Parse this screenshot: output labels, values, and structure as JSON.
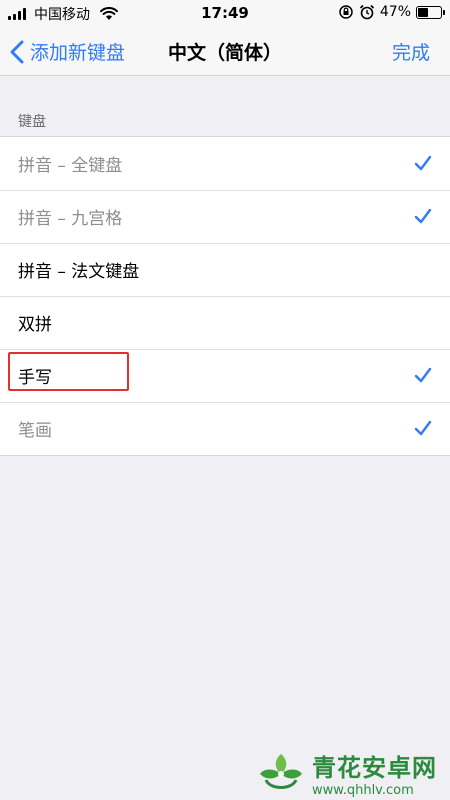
{
  "status_bar": {
    "carrier": "中国移动",
    "time": "17:49",
    "battery_percent": "47%",
    "battery_level": 0.47
  },
  "nav": {
    "back_label": "添加新键盘",
    "title": "中文（简体）",
    "done_label": "完成"
  },
  "section": {
    "header": "键盘",
    "rows": [
      {
        "label": "拼音 – 全键盘",
        "checked": true,
        "enabled": false
      },
      {
        "label": "拼音 – 九宫格",
        "checked": true,
        "enabled": false
      },
      {
        "label": "拼音 – 法文键盘",
        "checked": false,
        "enabled": true
      },
      {
        "label": "双拼",
        "checked": false,
        "enabled": true
      },
      {
        "label": "手写",
        "checked": true,
        "enabled": true
      },
      {
        "label": "笔画",
        "checked": true,
        "enabled": false
      }
    ]
  },
  "watermark": {
    "title": "青花安卓网",
    "url": "www.qhhlv.com"
  },
  "colors": {
    "accent": "#2f7cf6",
    "highlight": "#e0312f",
    "background": "#efeff4"
  }
}
